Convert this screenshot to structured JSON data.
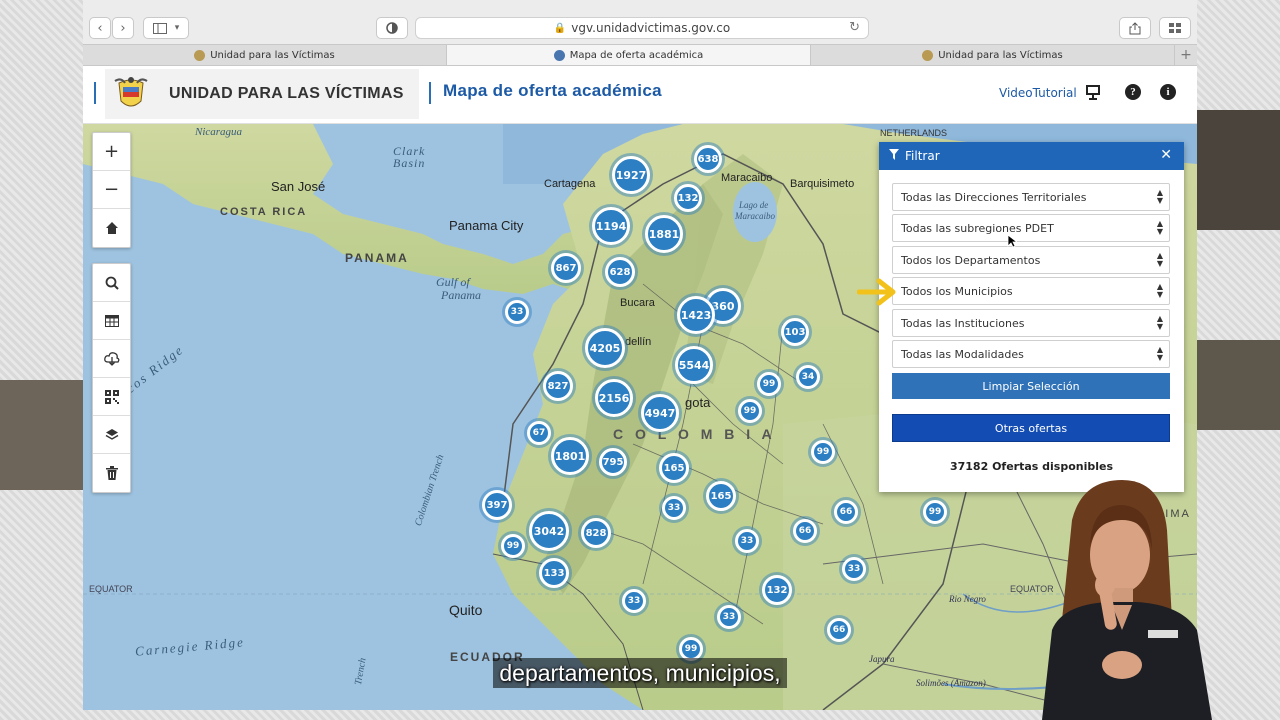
{
  "browser": {
    "url": "vgv.unidadvictimas.gov.co",
    "tabs": [
      {
        "label": "Unidad para las Víctimas",
        "active": false
      },
      {
        "label": "Mapa de oferta académica",
        "active": true
      },
      {
        "label": "Unidad para las Víctimas",
        "active": false
      }
    ]
  },
  "header": {
    "org_name": "UNIDAD PARA LAS VÍCTIMAS",
    "app_title": "Mapa de oferta académica",
    "video_link": "VideoTutorial",
    "help_glyph": "?",
    "info_glyph": "i"
  },
  "map": {
    "labels": {
      "nicaragua": "Nicaragua",
      "clark": "Clark",
      "basin": "Basin",
      "san_jose": "San José",
      "costa_rica": "COSTA RICA",
      "panama_city": "Panama City",
      "panama": "PANAMA",
      "gulf1": "Gulf of",
      "gulf2": "Panama",
      "cartagena": "Cartagena",
      "maracaibo": "Maracaibo",
      "lago1": "Lago de",
      "lago2": "Maracaibo",
      "barquisimeto": "Barquisimeto",
      "netherlands": "NETHERLANDS",
      "bucaramanga": "Bucara",
      "medellin": "dellín",
      "bogota": "gota",
      "colombia": "C O L O M B I A",
      "cocos": "cos Ridge",
      "trench": "Colombian Trench",
      "equator_left": "EQUATOR",
      "equator_right": "EQUATOR",
      "quito": "Quito",
      "ecuador": "ECUADOR",
      "carnegie": "Carnegie Ridge",
      "rio_negro": "Rio Negro",
      "japura": "Japura",
      "solimoes": "Solimões (Amazon)",
      "roraima": "RAIMA",
      "trench2": "Trench"
    },
    "clusters": [
      {
        "value": "1927"
      },
      {
        "value": "638"
      },
      {
        "value": "132"
      },
      {
        "value": "1194"
      },
      {
        "value": "1881"
      },
      {
        "value": "867"
      },
      {
        "value": "628"
      },
      {
        "value": "360"
      },
      {
        "value": "1423"
      },
      {
        "value": "33"
      },
      {
        "value": "103"
      },
      {
        "value": "4205"
      },
      {
        "value": "5544"
      },
      {
        "value": "827"
      },
      {
        "value": "2156"
      },
      {
        "value": "4947"
      },
      {
        "value": "99"
      },
      {
        "value": "34"
      },
      {
        "value": "99"
      },
      {
        "value": "67"
      },
      {
        "value": "1801"
      },
      {
        "value": "795"
      },
      {
        "value": "165"
      },
      {
        "value": "99"
      },
      {
        "value": "397"
      },
      {
        "value": "165"
      },
      {
        "value": "33"
      },
      {
        "value": "66"
      },
      {
        "value": "99"
      },
      {
        "value": "3042"
      },
      {
        "value": "828"
      },
      {
        "value": "33"
      },
      {
        "value": "66"
      },
      {
        "value": "99"
      },
      {
        "value": "133"
      },
      {
        "value": "33"
      },
      {
        "value": "132"
      },
      {
        "value": "33"
      },
      {
        "value": "33"
      },
      {
        "value": "66"
      },
      {
        "value": "99"
      }
    ]
  },
  "filter": {
    "title": "Filtrar",
    "close_glyph": "✕",
    "selects": [
      {
        "value": "Todas las Direcciones Territoriales"
      },
      {
        "value": "Todas las subregiones PDET"
      },
      {
        "value": "Todos los Departamentos"
      },
      {
        "value": "Todos los Municipios"
      },
      {
        "value": "Todas las Instituciones"
      },
      {
        "value": "Todas las Modalidades"
      }
    ],
    "clear_button": "Limpiar Selección",
    "other_button": "Otras ofertas",
    "offers_count": "37182 Ofertas disponibles"
  },
  "subtitle": "departamentos, municipios,",
  "colors": {
    "accent": "#1d5aa6",
    "filter_header": "#1f66b8",
    "cluster": "#2c7fc2",
    "ocean": "#9ec3e0",
    "land": "#c9d79e"
  }
}
